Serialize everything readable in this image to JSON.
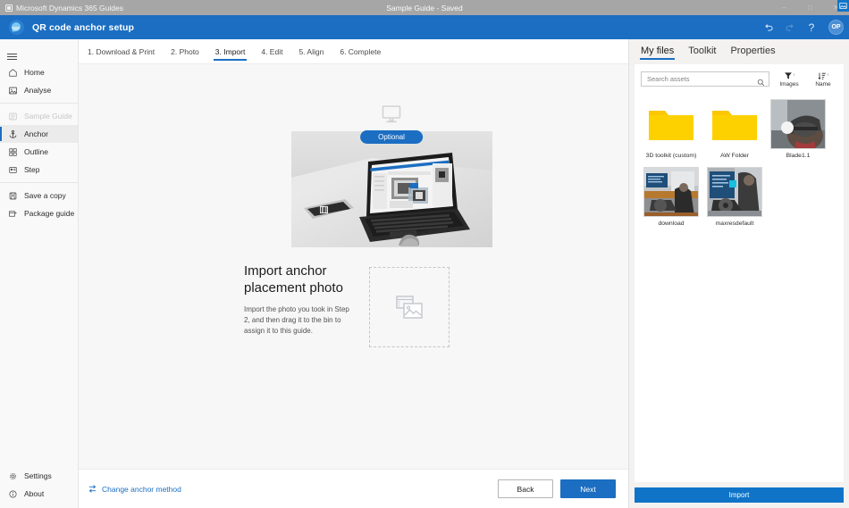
{
  "titlebar": {
    "app_name": "Microsoft Dynamics 365 Guides",
    "document_title": "Sample Guide - Saved",
    "minimize": "–",
    "maximize": "□",
    "close": "✕"
  },
  "header": {
    "title": "QR code anchor setup",
    "undo_icon": "undo-icon",
    "redo_icon": "redo-icon",
    "help_label": "?",
    "avatar_initials": "OP",
    "brand_color": "#1b6ec2"
  },
  "sidebar": {
    "menu_icon": "hamburger-icon",
    "items": [
      {
        "label": "Home",
        "icon": "home-icon",
        "state": "normal"
      },
      {
        "label": "Analyse",
        "icon": "analyse-icon",
        "state": "normal"
      },
      {
        "label": "Sample Guide",
        "icon": "guide-icon",
        "state": "disabled"
      },
      {
        "label": "Anchor",
        "icon": "anchor-icon",
        "state": "selected"
      },
      {
        "label": "Outline",
        "icon": "outline-icon",
        "state": "normal"
      },
      {
        "label": "Step",
        "icon": "step-icon",
        "state": "normal"
      },
      {
        "label": "Save a copy",
        "icon": "save-copy-icon",
        "state": "normal"
      },
      {
        "label": "Package guide",
        "icon": "package-icon",
        "state": "normal"
      }
    ],
    "bottom_items": [
      {
        "label": "Settings",
        "icon": "gear-icon"
      },
      {
        "label": "About",
        "icon": "info-icon"
      }
    ]
  },
  "steps": [
    {
      "label": "1. Download & Print",
      "active": false
    },
    {
      "label": "2. Photo",
      "active": false
    },
    {
      "label": "3. Import",
      "active": true
    },
    {
      "label": "4. Edit",
      "active": false
    },
    {
      "label": "5. Align",
      "active": false
    },
    {
      "label": "6. Complete",
      "active": false
    }
  ],
  "main": {
    "device_icon": "desktop-monitor-icon",
    "optional_badge": "Optional",
    "illustration": "laptop-with-guides-app-photo",
    "heading": "Import anchor placement photo",
    "description": "Import the photo you took in Step 2, and then drag it to the bin to assign it to this guide.",
    "dropzone_icon": "photos-placeholder-icon"
  },
  "actionbar": {
    "change_anchor_icon": "swap-arrows-icon",
    "change_anchor_label": "Change anchor method",
    "back_label": "Back",
    "next_label": "Next"
  },
  "rightpanel": {
    "tabs": [
      {
        "label": "My files",
        "active": true
      },
      {
        "label": "Toolkit",
        "active": false
      },
      {
        "label": "Properties",
        "active": false
      }
    ],
    "search": {
      "placeholder": "Search assets",
      "value": "",
      "icon": "search-icon"
    },
    "filter": {
      "icon": "filter-funnel-icon",
      "label": "Images",
      "chevron": "›"
    },
    "sort": {
      "icon": "sort-icon",
      "label": "Name",
      "chevron": "›"
    },
    "assets": [
      {
        "name": "3D toolkit (custom)",
        "type": "folder",
        "badge": null
      },
      {
        "name": "AW Folder",
        "type": "folder",
        "badge": null
      },
      {
        "name": "Blade1.1",
        "type": "image",
        "badge": "image-badge-icon"
      },
      {
        "name": "download",
        "type": "image",
        "badge": "image-badge-icon"
      },
      {
        "name": "maxresdefault",
        "type": "image",
        "badge": "image-badge-icon"
      }
    ],
    "import_label": "Import",
    "accent_color": "#0f74c8"
  }
}
